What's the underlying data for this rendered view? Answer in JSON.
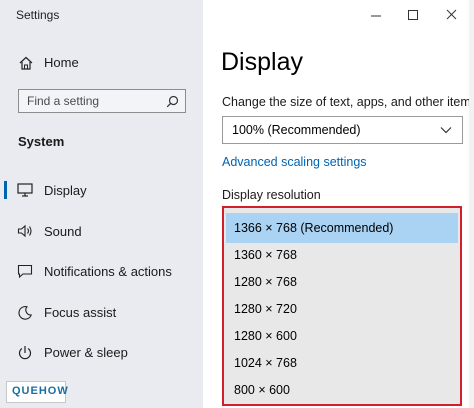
{
  "window": {
    "title": "Settings",
    "controls": [
      "minimize-icon",
      "maximize-icon",
      "close-icon"
    ]
  },
  "sidebar": {
    "home_label": "Home",
    "search": {
      "placeholder": "Find a setting",
      "value": ""
    },
    "section_label": "System",
    "items": [
      {
        "label": "Display",
        "icon": "monitor-icon",
        "active": true
      },
      {
        "label": "Sound",
        "icon": "speaker-icon",
        "active": false
      },
      {
        "label": "Notifications & actions",
        "icon": "notification-icon",
        "active": false
      },
      {
        "label": "Focus assist",
        "icon": "moon-icon",
        "active": false
      },
      {
        "label": "Power & sleep",
        "icon": "power-icon",
        "active": false
      }
    ],
    "watermark": "QUEHOW"
  },
  "main": {
    "page_title": "Display",
    "scale_label": "Change the size of text, apps, and other items",
    "scale_value": "100% (Recommended)",
    "advanced_link": "Advanced scaling settings",
    "resolution_label": "Display resolution",
    "resolutions": [
      {
        "label": "1366 × 768 (Recommended)",
        "selected": true
      },
      {
        "label": "1360 × 768",
        "selected": false
      },
      {
        "label": "1280 × 768",
        "selected": false
      },
      {
        "label": "1280 × 720",
        "selected": false
      },
      {
        "label": "1280 × 600",
        "selected": false
      },
      {
        "label": "1024 × 768",
        "selected": false
      },
      {
        "label": "800 × 600",
        "selected": false
      }
    ]
  },
  "colors": {
    "accent": "#0063b1",
    "highlight_border": "#d11f2b",
    "selected_row": "#a9d2f3",
    "sidebar_bg": "#e9ebf1"
  }
}
